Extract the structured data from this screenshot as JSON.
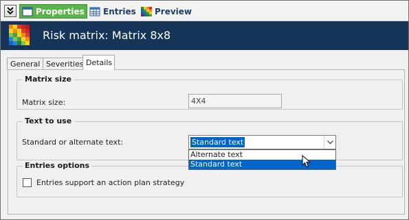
{
  "toolbar": {
    "tabs": [
      {
        "label": "Properties",
        "icon": "window-icon",
        "active": true
      },
      {
        "label": "Entries",
        "icon": "table-icon"
      },
      {
        "label": "Preview",
        "icon": "matrix-icon"
      }
    ]
  },
  "header": {
    "title": "Risk matrix: Matrix 8x8"
  },
  "tabs": [
    "General",
    "Severities",
    "Details"
  ],
  "active_tab": "Details",
  "matrix_size_group": {
    "title": "Matrix size",
    "label": "Matrix size:",
    "value": "4X4"
  },
  "text_to_use_group": {
    "title": "Text to use",
    "label": "Standard or alternate text:",
    "selected": "Standard text",
    "options": [
      "Alternate text",
      "Standard text"
    ],
    "highlighted_option": "Standard text"
  },
  "entries_options_group": {
    "title": "Entries options",
    "checkbox_label": "Entries support an action plan strategy",
    "checked": false
  },
  "colors": {
    "header_bg": "#163457",
    "active_tab_bg": "#5bb44a",
    "selection": "#0066cc"
  }
}
